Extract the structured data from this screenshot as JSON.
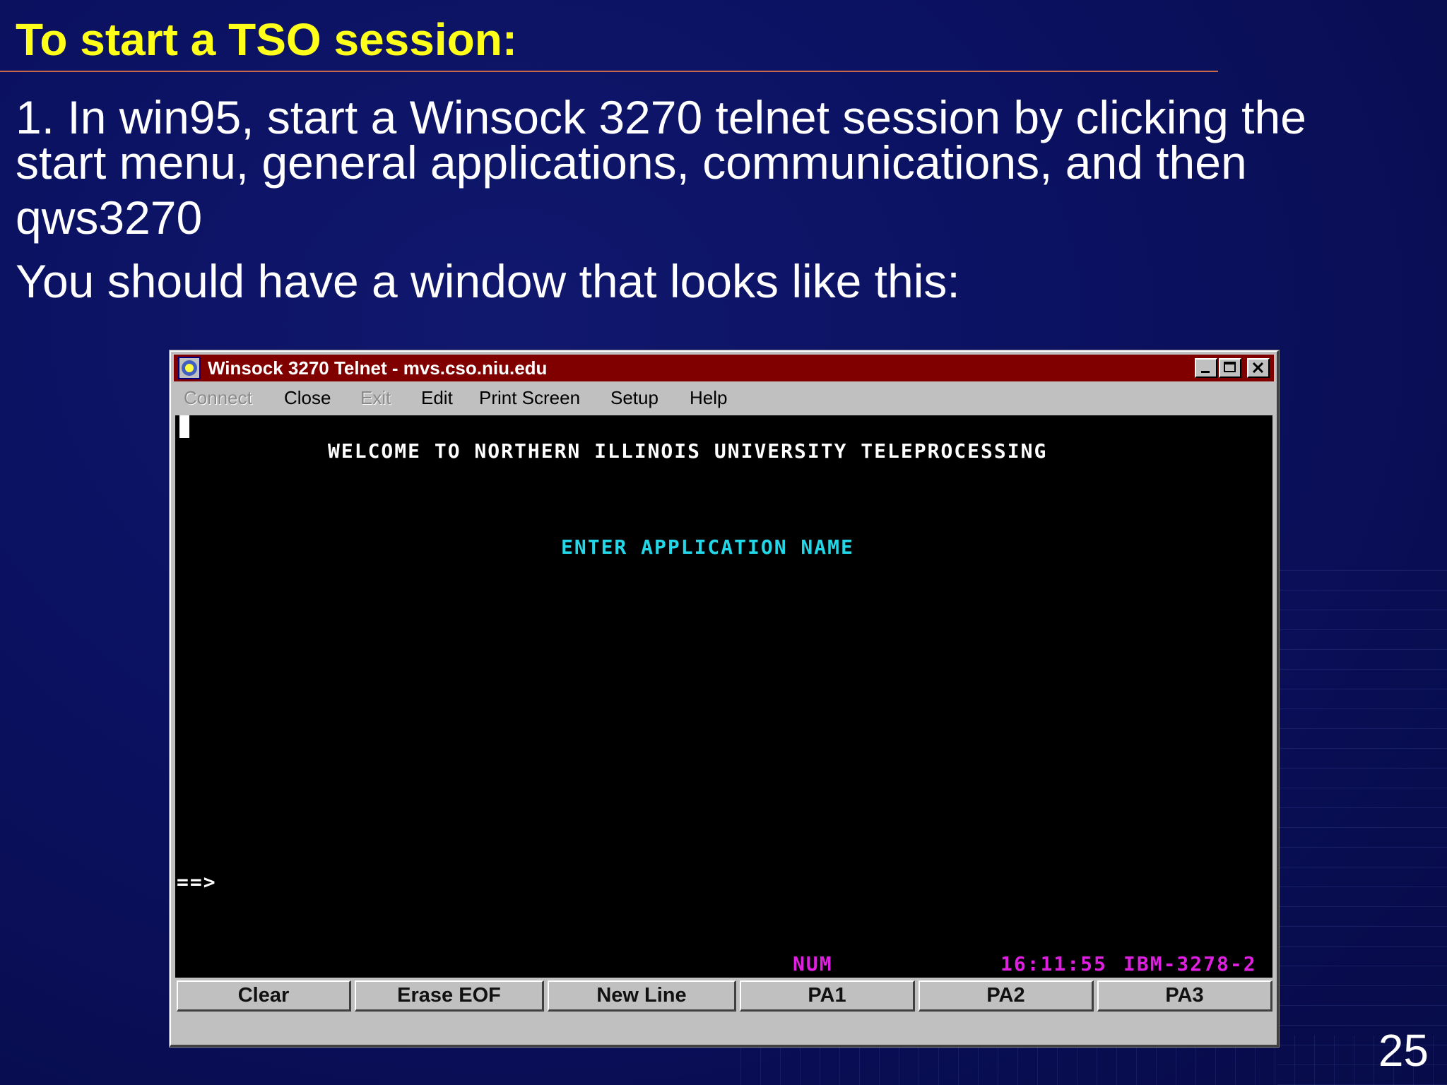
{
  "slide": {
    "title": "To start a TSO session:",
    "step1_line1": "1.  In win95, start a Winsock 3270 telnet session by clicking the",
    "step1_line2": "start menu, general applications, communications, and then",
    "step1_line3": "qws3270",
    "step2": "You should have a window that looks like this:",
    "page_number": "25"
  },
  "window": {
    "title": "Winsock 3270 Telnet - mvs.cso.niu.edu",
    "menu": {
      "connect": "Connect",
      "close": "Close",
      "exit": "Exit",
      "edit": "Edit",
      "print_screen": "Print Screen",
      "setup": "Setup",
      "help": "Help"
    },
    "terminal": {
      "welcome": "WELCOME TO NORTHERN ILLINOIS UNIVERSITY TELEPROCESSING",
      "enter_app": "ENTER APPLICATION NAME",
      "prompt": "==>",
      "num_indicator": "NUM",
      "time": "16:11:55",
      "terminal_type": "IBM-3278-2"
    },
    "keys": {
      "clear": "Clear",
      "erase_eof": "Erase EOF",
      "new_line": "New Line",
      "pa1": "PA1",
      "pa2": "PA2",
      "pa3": "PA3"
    }
  },
  "colors": {
    "title_yellow": "#ffff1a",
    "titlebar_maroon": "#800000",
    "terminal_cyan": "#22d8e8",
    "terminal_magenta": "#e020e0"
  }
}
